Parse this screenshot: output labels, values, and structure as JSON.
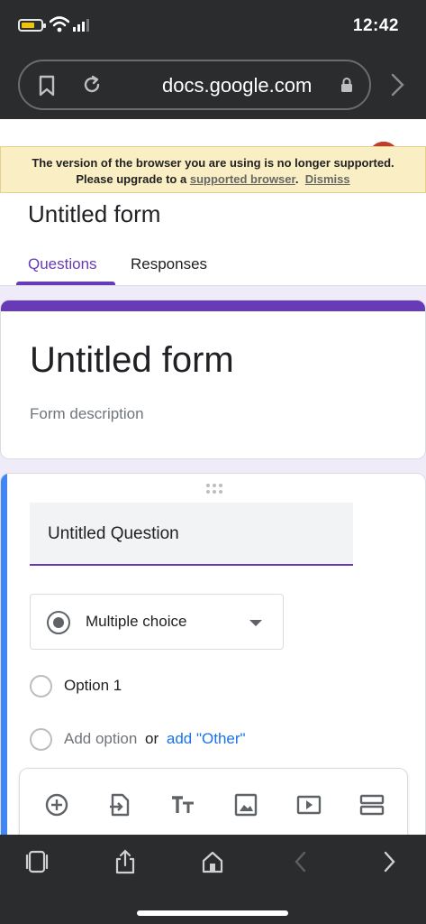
{
  "status_bar": {
    "time": "12:42"
  },
  "browser": {
    "url": "docs.google.com"
  },
  "banner": {
    "line1": "The version of the browser you are using is no longer supported.",
    "line2_prefix": "Please upgrade to a",
    "supported_link": "supported browser",
    "period": ".",
    "dismiss": "Dismiss"
  },
  "form_header": {
    "title": "Untitled form",
    "tabs": [
      {
        "label": "Questions",
        "active": true
      },
      {
        "label": "Responses",
        "active": false
      }
    ]
  },
  "title_card": {
    "title": "Untitled form",
    "description_placeholder": "Form description"
  },
  "question": {
    "title": "Untitled Question",
    "type": "Multiple choice",
    "options": [
      "Option 1"
    ],
    "add_option": "Add option",
    "or": "or",
    "add_other": "add \"Other\""
  },
  "toolbar": {
    "icons": [
      "add-question-icon",
      "import-questions-icon",
      "add-title-icon",
      "add-image-icon",
      "add-video-icon",
      "add-section-icon"
    ]
  },
  "bottom_bar": {
    "icons": [
      "tabs-icon",
      "share-icon",
      "home-icon",
      "back-icon",
      "forward-icon"
    ]
  },
  "colors": {
    "accent": "#673ab7",
    "question_bar": "#4285f4",
    "banner_bg": "#faefc4",
    "link_blue": "#1a73e8",
    "chrome": "#2b2c2e"
  }
}
